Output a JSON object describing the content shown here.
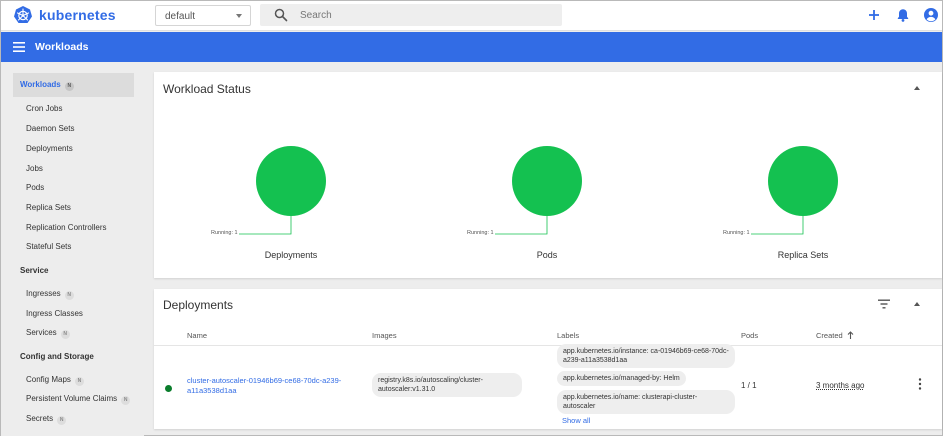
{
  "app": {
    "name": "kubernetes"
  },
  "namespace": {
    "selected": "default"
  },
  "search": {
    "placeholder": "Search"
  },
  "topbar": {
    "icons": [
      "add-icon",
      "notifications-icon",
      "account-icon"
    ]
  },
  "page": {
    "title": "Workloads"
  },
  "sidebar": {
    "workloads": {
      "label": "Workloads",
      "badge": "N"
    },
    "workload_items": [
      "Cron Jobs",
      "Daemon Sets",
      "Deployments",
      "Jobs",
      "Pods",
      "Replica Sets",
      "Replication Controllers",
      "Stateful Sets"
    ],
    "service": {
      "header": "Service",
      "ingresses": {
        "label": "Ingresses",
        "badge": "N"
      },
      "ingress_classes": {
        "label": "Ingress Classes"
      },
      "services": {
        "label": "Services",
        "badge": "N"
      }
    },
    "config": {
      "header": "Config and Storage",
      "config_maps": {
        "label": "Config Maps",
        "badge": "N"
      },
      "pvc": {
        "label": "Persistent Volume Claims",
        "badge": "N"
      },
      "secrets": {
        "label": "Secrets",
        "badge": "N"
      }
    }
  },
  "workload_status": {
    "title": "Workload Status",
    "charts": [
      {
        "name": "Deployments",
        "running_label": "Running: 1",
        "running": 1,
        "color": "#14c150"
      },
      {
        "name": "Pods",
        "running_label": "Running: 1",
        "running": 1,
        "color": "#14c150"
      },
      {
        "name": "Replica Sets",
        "running_label": "Running: 1",
        "running": 1,
        "color": "#14c150"
      }
    ]
  },
  "deployments": {
    "title": "Deployments",
    "columns": {
      "name": "Name",
      "images": "Images",
      "labels": "Labels",
      "pods": "Pods",
      "created": "Created"
    },
    "sort_icon": "arrow-up-icon",
    "rows": [
      {
        "status_color": "#0a7d2c",
        "name": "cluster-autoscaler-01946b69-ce68-70dc-a239-a11a3538d1aa",
        "image": "registry.k8s.io/autoscaling/cluster-autoscaler:v1.31.0",
        "labels": [
          "app.kubernetes.io/instance: ca-01946b69-ce68-70dc-a239-a11a3538d1aa",
          "app.kubernetes.io/managed-by: Helm",
          "app.kubernetes.io/name: clusterapi-cluster-autoscaler"
        ],
        "show_all": "Show all",
        "pods": "1 / 1",
        "created": "3 months ago"
      }
    ]
  },
  "colors": {
    "brand": "#326ce5",
    "running": "#14c150",
    "ok_status": "#0a7d2c"
  }
}
